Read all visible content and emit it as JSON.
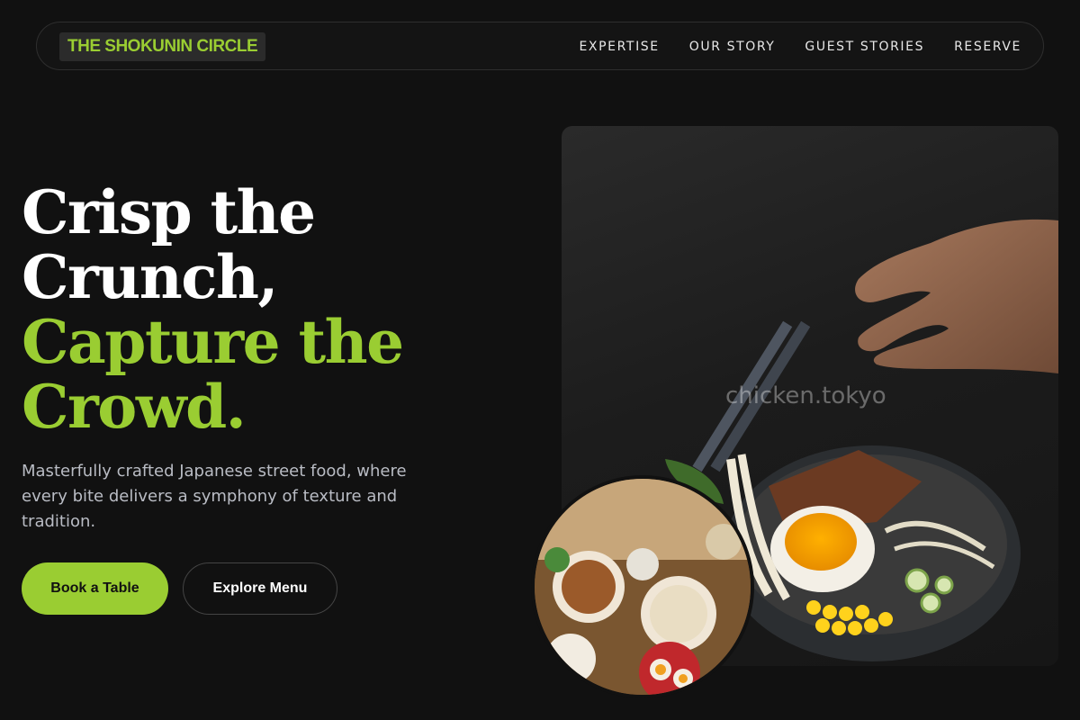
{
  "brand": {
    "name": "THE SHOKUNIN CIRCLE"
  },
  "nav": {
    "items": [
      "EXPERTISE",
      "OUR STORY",
      "GUEST STORIES",
      "RESERVE"
    ]
  },
  "hero": {
    "headline_line1": "Crisp the",
    "headline_line2": "Crunch,",
    "headline_line3": "Capture the",
    "headline_line4": "Crowd.",
    "description": "Masterfully crafted Japanese street food, where every bite delivers a symphony of texture and tradition.",
    "primary_cta": "Book a Table",
    "secondary_cta": "Explore Menu"
  },
  "image": {
    "watermark": "chicken.tokyo"
  },
  "colors": {
    "accent": "#9acd32",
    "background": "#111111",
    "text_muted": "#b9bcc4"
  }
}
